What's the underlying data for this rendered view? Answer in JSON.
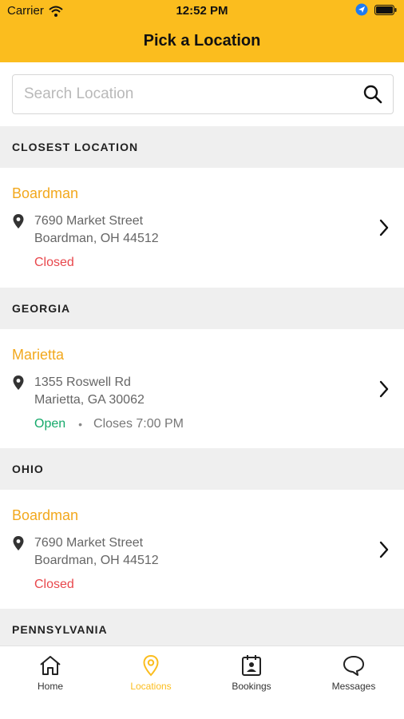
{
  "status_bar": {
    "carrier": "Carrier",
    "time": "12:52 PM"
  },
  "nav": {
    "title": "Pick a Location"
  },
  "search": {
    "placeholder": "Search Location",
    "value": ""
  },
  "sections": [
    {
      "title": "CLOSEST LOCATION",
      "locations": [
        {
          "name": "Boardman",
          "address_line1": "7690 Market Street",
          "address_line2": "Boardman, OH 44512",
          "status": "Closed",
          "hours": ""
        }
      ]
    },
    {
      "title": "GEORGIA",
      "locations": [
        {
          "name": "Marietta",
          "address_line1": "1355 Roswell Rd",
          "address_line2": "Marietta, GA 30062",
          "status": "Open",
          "hours": "Closes 7:00 PM"
        }
      ]
    },
    {
      "title": "OHIO",
      "locations": [
        {
          "name": "Boardman",
          "address_line1": "7690 Market Street",
          "address_line2": "Boardman, OH 44512",
          "status": "Closed",
          "hours": ""
        }
      ]
    },
    {
      "title": "PENNSYLVANIA",
      "locations": []
    }
  ],
  "tabbar": {
    "active": "Locations",
    "items": [
      {
        "label": "Home",
        "icon": "home-icon"
      },
      {
        "label": "Locations",
        "icon": "location-pin-icon"
      },
      {
        "label": "Bookings",
        "icon": "bookings-calendar-icon"
      },
      {
        "label": "Messages",
        "icon": "chat-bubble-icon"
      }
    ]
  },
  "colors": {
    "brand_yellow": "#FBBD1E",
    "location_name": "#F2A81D",
    "status_closed": "#E8474C",
    "status_open": "#15A96A",
    "section_bg": "#EFEFEF"
  }
}
